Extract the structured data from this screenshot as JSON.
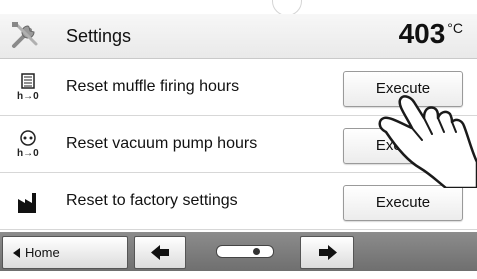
{
  "header": {
    "title": "Settings",
    "temperature": "403",
    "unit": "°C"
  },
  "rows": [
    {
      "label": "Reset muffle firing hours",
      "button": "Execute",
      "icon": "muffle-hours-icon"
    },
    {
      "label": "Reset vacuum pump hours",
      "button": "Execute",
      "icon": "vacuum-pump-icon"
    },
    {
      "label": "Reset to factory settings",
      "button": "Execute",
      "icon": "factory-icon"
    }
  ],
  "footer": {
    "home_label": "Home",
    "slider_level": 0.75
  },
  "colors": {
    "footer_bar": "#7a7a7a",
    "button_border": "#9a9a9a"
  }
}
